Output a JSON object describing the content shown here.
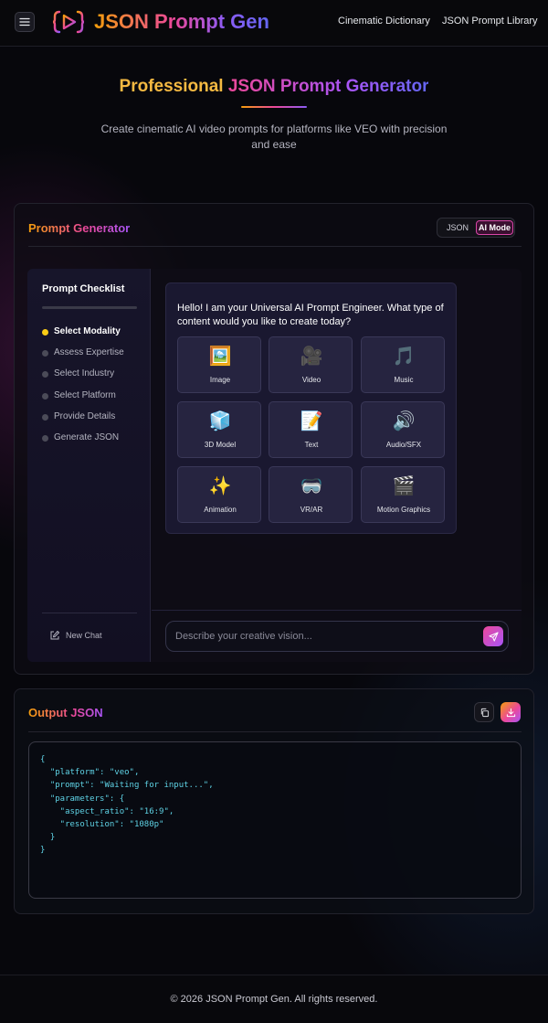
{
  "header": {
    "brand": "JSON Prompt Gen",
    "nav": [
      "Cinematic Dictionary",
      "JSON Prompt Library"
    ],
    "icons": {
      "menu": "hamburger-menu-icon",
      "logo": "play-braces-logo-icon"
    }
  },
  "hero": {
    "title_part1": "Professional ",
    "title_part2": "JSON Prompt Generator",
    "subtitle": "Create cinematic AI video prompts for platforms like VEO with precision and ease"
  },
  "generator": {
    "title": "Prompt Generator",
    "modes": [
      "JSON",
      "AI Mode"
    ],
    "active_mode": "AI Mode",
    "checklist": {
      "title": "Prompt Checklist",
      "progress": 0,
      "items": [
        {
          "label": "Select Modality",
          "active": true
        },
        {
          "label": "Assess Expertise",
          "active": false
        },
        {
          "label": "Select Industry",
          "active": false
        },
        {
          "label": "Select Platform",
          "active": false
        },
        {
          "label": "Provide Details",
          "active": false
        },
        {
          "label": "Generate JSON",
          "active": false
        }
      ]
    },
    "new_chat": "New Chat",
    "message": "Hello! I am your Universal AI Prompt Engineer. What type of content would you like to create today?",
    "options": [
      {
        "label": "Image",
        "icon": "🖼️"
      },
      {
        "label": "Video",
        "icon": "🎥"
      },
      {
        "label": "Music",
        "icon": "🎵"
      },
      {
        "label": "3D Model",
        "icon": "🧊"
      },
      {
        "label": "Text",
        "icon": "📝"
      },
      {
        "label": "Audio/SFX",
        "icon": "🔊"
      },
      {
        "label": "Animation",
        "icon": "✨"
      },
      {
        "label": "VR/AR",
        "icon": "🥽"
      },
      {
        "label": "Motion Graphics",
        "icon": "🎬"
      }
    ],
    "input_placeholder": "Describe your creative vision...",
    "colors": {
      "accent_pink": "#ec4899",
      "accent_purple": "#a855f7",
      "accent_amber": "#f59e0b",
      "active_dot": "#facc15"
    }
  },
  "output": {
    "title": "Output JSON",
    "code": "{\n  \"platform\": \"veo\",\n  \"prompt\": \"Waiting for input...\",\n  \"parameters\": {\n    \"aspect_ratio\": \"16:9\",\n    \"resolution\": \"1080p\"\n  }\n}"
  },
  "footer": {
    "text": "© 2026 JSON Prompt Gen. All rights reserved."
  }
}
